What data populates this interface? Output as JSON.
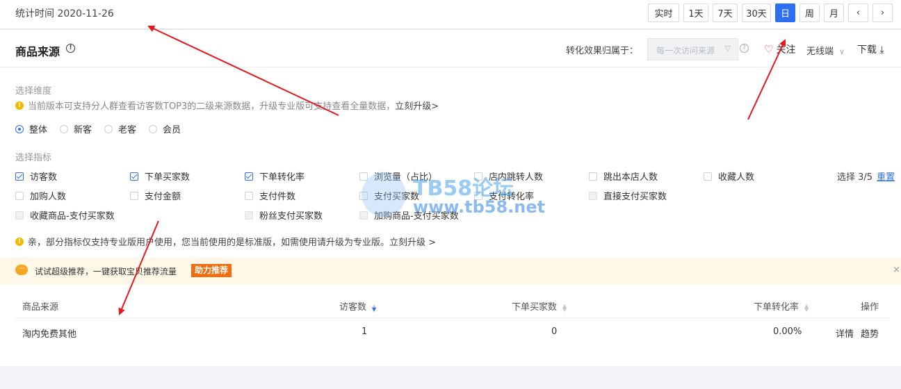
{
  "topbar": {
    "stat_time": "统计时间 2020-11-26",
    "periods": [
      {
        "label": "实时",
        "active": false
      },
      {
        "label": "1天",
        "active": false
      },
      {
        "label": "7天",
        "active": false
      },
      {
        "label": "30天",
        "active": false
      },
      {
        "label": "日",
        "active": true
      },
      {
        "label": "周",
        "active": false
      },
      {
        "label": "月",
        "active": false
      }
    ],
    "prev": "‹",
    "next": "›"
  },
  "header": {
    "title": "商品来源",
    "info": "!",
    "attribution_label": "转化效果归属于：",
    "attribution_value": "每一次访问来源",
    "help": "?",
    "follow": "关注",
    "device": "无线端",
    "download": "下载"
  },
  "dimension": {
    "label": "选择维度",
    "notice": "当前版本可支持分人群查看访客数TOP3的二级来源数据，升级专业版可支持查看全量数据，",
    "upgrade": "立刻升级>",
    "options": [
      {
        "label": "整体",
        "checked": true
      },
      {
        "label": "新客",
        "checked": false
      },
      {
        "label": "老客",
        "checked": false
      },
      {
        "label": "会员",
        "checked": false
      }
    ]
  },
  "metrics": {
    "label": "选择指标",
    "items": [
      {
        "label": "访客数",
        "state": "on"
      },
      {
        "label": "下单买家数",
        "state": "on"
      },
      {
        "label": "下单转化率",
        "state": "on"
      },
      {
        "label": "浏览量（占比）",
        "state": "off"
      },
      {
        "label": "店内跳转人数",
        "state": "off"
      },
      {
        "label": "跳出本店人数",
        "state": "off"
      },
      {
        "label": "收藏人数",
        "state": "off"
      },
      {
        "label": "加购人数",
        "state": "off"
      },
      {
        "label": "支付金额",
        "state": "off"
      },
      {
        "label": "支付件数",
        "state": "off"
      },
      {
        "label": "支付买家数",
        "state": "off"
      },
      {
        "label": "支付转化率",
        "state": "off"
      },
      {
        "label": "直接支付买家数",
        "state": "dis"
      },
      {
        "label": "收藏商品-支付买家数",
        "state": "dis"
      },
      {
        "label": "粉丝支付买家数",
        "state": "dis"
      },
      {
        "label": "加购商品-支付买家数",
        "state": "dis"
      }
    ],
    "count": "选择 3/5",
    "reset": "重置",
    "notice": "亲，部分指标仅支持专业版用户使用，您当前使用的是标准版，如需使用请升级为专业版。",
    "upgrade": "立刻升级 >"
  },
  "promo": {
    "icon": "···",
    "text": "试试超级推荐，一键获取宝贝推荐流量",
    "tag": "助力推荐",
    "close": "×"
  },
  "table": {
    "headers": [
      "商品来源",
      "访客数",
      "下单买家数",
      "下单转化率",
      "操作"
    ],
    "rows": [
      {
        "source": "淘内免费其他",
        "visitors": "1",
        "buyers": "0",
        "rate": "0.00%",
        "detail": "详情",
        "trend": "趋势"
      }
    ]
  },
  "watermark": {
    "line1": "TB58论坛",
    "line2": "www.tb58.net"
  }
}
